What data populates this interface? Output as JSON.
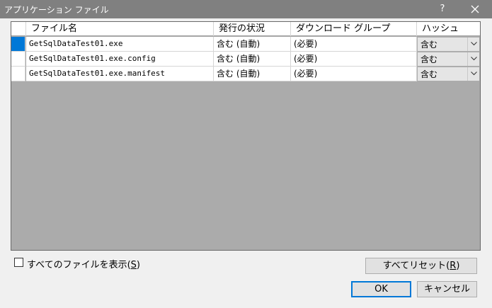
{
  "window": {
    "title": "アプリケーション ファイル",
    "help_label": "?"
  },
  "grid": {
    "columns": [
      "ファイル名",
      "発行の状況",
      "ダウンロード グループ",
      "ハッシュ"
    ],
    "sorted_column": "ファイル名",
    "rows": [
      {
        "file": "GetSqlDataTest01.exe",
        "status": "含む (自動)",
        "group": "(必要)",
        "hash": "含む",
        "selected": true
      },
      {
        "file": "GetSqlDataTest01.exe.config",
        "status": "含む (自動)",
        "group": "(必要)",
        "hash": "含む",
        "selected": false
      },
      {
        "file": "GetSqlDataTest01.exe.manifest",
        "status": "含む (自動)",
        "group": "(必要)",
        "hash": "含む",
        "selected": false
      }
    ]
  },
  "show_all": {
    "label": "すべてのファイルを表示(",
    "mnemonic": "S",
    "label_end": ")",
    "checked": false
  },
  "buttons": {
    "reset_label": "すべてリセット(",
    "reset_mnemonic": "R",
    "reset_end": ")",
    "ok_label": "OK",
    "cancel_label": "キャンセル"
  },
  "colors": {
    "titlebar": "#808080",
    "selection": "#0078d7",
    "grid_background": "#ababab",
    "dialog_background": "#f0f0f0"
  }
}
